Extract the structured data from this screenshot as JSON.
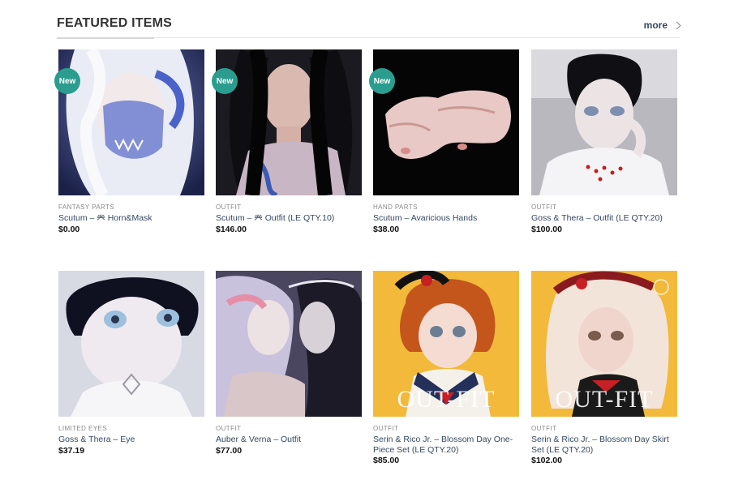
{
  "section": {
    "title": "FEATURED ITEMS",
    "more_label": "more"
  },
  "badge_label": "New",
  "products": [
    {
      "category": "FANTASY PARTS",
      "name": "Scutum – 𠔉 Horn&Mask",
      "price": "$0.00",
      "is_new": true,
      "image": "white-hair-doll-with-blue-mask"
    },
    {
      "category": "OUTFIT",
      "name": "Scutum – 𠔉 Outfit (LE QTY.10)",
      "price": "$146.00",
      "is_new": true,
      "image": "long-black-hair-doll-outfit"
    },
    {
      "category": "HAND PARTS",
      "name": "Scutum – Avaricious Hands",
      "price": "$38.00",
      "is_new": true,
      "image": "doll-hands-on-black"
    },
    {
      "category": "OUTFIT",
      "name": "Goss & Thera – Outfit (LE QTY.20)",
      "price": "$100.00",
      "is_new": false,
      "image": "dark-hair-doll-white-outfit"
    },
    {
      "category": "LIMITED EYES",
      "name": "Goss & Thera – Eye",
      "price": "$37.19",
      "is_new": false,
      "image": "doll-with-blue-eyes"
    },
    {
      "category": "OUTFIT",
      "name": "Auber & Verna – Outfit",
      "price": "$77.00",
      "is_new": false,
      "image": "two-dolls-lavender"
    },
    {
      "category": "OUTFIT",
      "name": "Serin & Rico Jr. – Blossom Day One-Piece Set (LE QTY.20)",
      "price": "$85.00",
      "is_new": false,
      "image": "red-hair-doll-yellow-bg",
      "overlay": "OUT-FIT"
    },
    {
      "category": "OUTFIT",
      "name": "Serin & Rico Jr. – Blossom Day Skirt Set (LE QTY.20)",
      "price": "$102.00",
      "is_new": false,
      "image": "blonde-doll-yellow-bg",
      "overlay": "OUT-FIT"
    }
  ],
  "colors": {
    "link": "#334862",
    "badge": "#2a9d8f",
    "category": "#8a8a8a"
  }
}
